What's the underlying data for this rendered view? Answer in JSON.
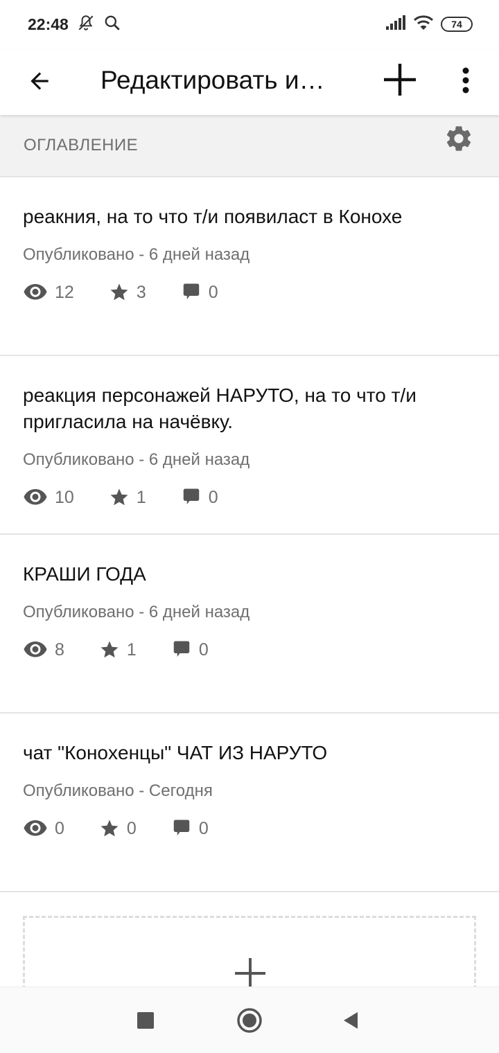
{
  "status_bar": {
    "time": "22:48",
    "battery": "74",
    "icons": [
      "bell-off-icon",
      "search-icon",
      "signal-icon",
      "wifi-icon",
      "battery-icon"
    ]
  },
  "app_bar": {
    "title": "Редактировать и…",
    "icons": [
      "back-arrow-icon",
      "plus-icon",
      "more-vert-icon"
    ]
  },
  "toc": {
    "title": "ОГЛАВЛЕНИЕ",
    "icon": "gear-icon"
  },
  "parts": [
    {
      "title": "реакния, на то что т/и появиласт в Конохе",
      "status": "Опубликовано - 6 дней назад",
      "views": "12",
      "votes": "3",
      "comments": "0"
    },
    {
      "title": "реакция персонажей НАРУТО, на то что т/и пригласила на начёвку.",
      "status": "Опубликовано - 6 дней назад",
      "views": "10",
      "votes": "1",
      "comments": "0"
    },
    {
      "title": "КРАШИ ГОДА",
      "status": "Опубликовано - 6 дней назад",
      "views": "8",
      "votes": "1",
      "comments": "0"
    },
    {
      "title": "чат \"Коноxенцы\" ЧАТ ИЗ НАРУТО",
      "status": "Опубликовано - Сегодня",
      "views": "0",
      "votes": "0",
      "comments": "0"
    }
  ],
  "add_part": {
    "icon": "plus-icon"
  },
  "nav_bar": {
    "icons": [
      "recents-square-icon",
      "home-circle-icon",
      "back-triangle-icon"
    ]
  },
  "colors": {
    "text": "#121212",
    "secondary": "#6f6f6f",
    "divider": "#e4e4e4",
    "header_bg": "#f2f2f3"
  }
}
